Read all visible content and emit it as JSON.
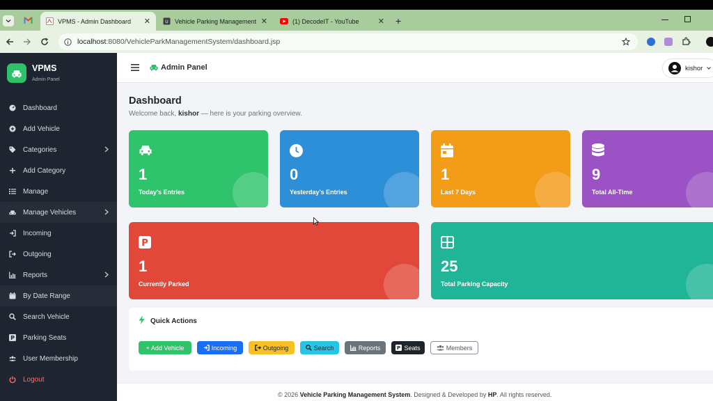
{
  "browser": {
    "tabs": [
      {
        "title": "VPMS - Admin Dashboard"
      },
      {
        "title": "Vehicle Parking Management Sy"
      },
      {
        "title": "(1) DecodeIT - YouTube"
      }
    ],
    "url_host": "localhost",
    "url_path": ":8080/VehicleParkManagementSystem/dashboard.jsp"
  },
  "sidebar": {
    "brand": "VPMS",
    "brand_sub": "Admin Panel",
    "items": [
      {
        "label": "Dashboard",
        "icon": "gauge-icon"
      },
      {
        "label": "Add Vehicle",
        "icon": "plus-circle-icon"
      },
      {
        "label": "Categories",
        "icon": "tag-icon"
      },
      {
        "label": "Add Category",
        "icon": "plus-icon"
      },
      {
        "label": "Manage",
        "icon": "list-icon"
      },
      {
        "label": "Manage Vehicles",
        "icon": "car-icon"
      },
      {
        "label": "Incoming",
        "icon": "sign-in-icon"
      },
      {
        "label": "Outgoing",
        "icon": "sign-out-icon"
      },
      {
        "label": "Reports",
        "icon": "chart-icon"
      },
      {
        "label": "By Date Range",
        "icon": "calendar-icon"
      },
      {
        "label": "Search Vehicle",
        "icon": "search-icon"
      },
      {
        "label": "Parking Seats",
        "icon": "parking-icon"
      },
      {
        "label": "User Membership",
        "icon": "users-icon"
      },
      {
        "label": "Logout",
        "icon": "power-icon"
      }
    ]
  },
  "topbar": {
    "title": "Admin Panel",
    "user": "kishor"
  },
  "dashboard": {
    "title": "Dashboard",
    "welcome_prefix": "Welcome back,",
    "welcome_user": "kishor",
    "welcome_suffix": "— here is your parking overview."
  },
  "stats": [
    {
      "value": "1",
      "label": "Today's Entries",
      "color": "#2fc36b"
    },
    {
      "value": "0",
      "label": "Yesterday's Entries",
      "color": "#2d8fd8"
    },
    {
      "value": "1",
      "label": "Last 7 Days",
      "color": "#f39c18"
    },
    {
      "value": "9",
      "label": "Total All-Time",
      "color": "#9b52c4"
    },
    {
      "value": "1",
      "label": "Currently Parked",
      "color": "#e2483a"
    },
    {
      "value": "25",
      "label": "Total Parking Capacity",
      "color": "#1fb596"
    }
  ],
  "quick_actions": {
    "title": "Quick Actions",
    "buttons": [
      {
        "label": "+ Add Vehicle",
        "color": "#2fc36b"
      },
      {
        "label": "Incoming",
        "color": "#1a6ef5"
      },
      {
        "label": "Outgoing",
        "color": "#f6c026"
      },
      {
        "label": "Search",
        "color": "#28c4e6"
      },
      {
        "label": "Reports",
        "color": "#6b737c"
      },
      {
        "label": "Seats",
        "color": "#1f232a"
      },
      {
        "label": "Members",
        "color": "#ffffff"
      }
    ]
  },
  "footer": {
    "prefix": "© 2026",
    "app": "Vehicle Parking Management System",
    "mid": ". Designed & Developed by",
    "author": "HP",
    "suffix": ". All rights reserved."
  }
}
